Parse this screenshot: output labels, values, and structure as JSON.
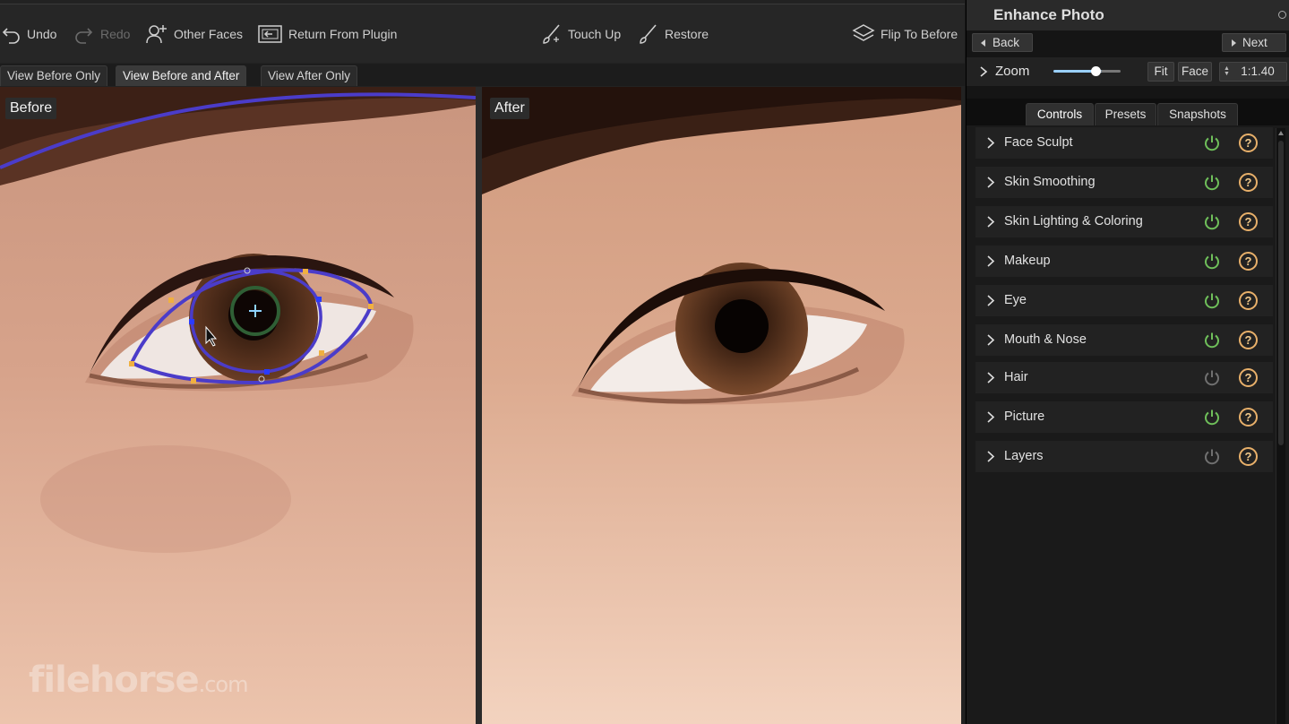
{
  "toolbar": {
    "undo_label": "Undo",
    "redo_label": "Redo",
    "other_faces_label": "Other Faces",
    "return_label": "Return From Plugin",
    "touch_up_label": "Touch Up",
    "restore_label": "Restore",
    "flip_label": "Flip To Before"
  },
  "view_tabs": {
    "before_only": "View Before Only",
    "before_and_after": "View Before and After",
    "after_only": "View After Only"
  },
  "panels": {
    "before_label": "Before",
    "after_label": "After"
  },
  "watermark": {
    "brand": "filehorse",
    "suffix": ".com"
  },
  "sidebar": {
    "title": "Enhance Photo",
    "back_label": "Back",
    "next_label": "Next",
    "zoom_label": "Zoom",
    "zoom_level": 0.6,
    "fit_label": "Fit",
    "face_label": "Face",
    "ratio": "1:1.40",
    "tabs": {
      "controls": "Controls",
      "presets": "Presets",
      "snapshots": "Snapshots"
    },
    "sections": [
      {
        "label": "Face Sculpt",
        "enabled": true
      },
      {
        "label": "Skin Smoothing",
        "enabled": true
      },
      {
        "label": "Skin Lighting & Coloring",
        "enabled": true
      },
      {
        "label": "Makeup",
        "enabled": true
      },
      {
        "label": "Eye",
        "enabled": true
      },
      {
        "label": "Mouth & Nose",
        "enabled": true
      },
      {
        "label": "Hair",
        "enabled": false
      },
      {
        "label": "Picture",
        "enabled": true
      },
      {
        "label": "Layers",
        "enabled": false
      }
    ],
    "help_glyph": "?"
  },
  "colors": {
    "power_on": "#6fbf5a",
    "power_off": "#707070",
    "overlay_line": "#4b3cc9",
    "handle": "#f0b040"
  }
}
